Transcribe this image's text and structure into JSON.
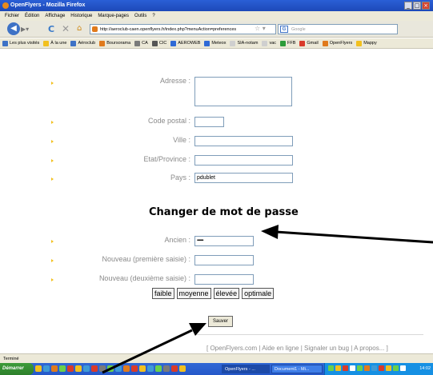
{
  "window": {
    "title": "OpenFlyers - Mozilla Firefox",
    "controls": [
      "_",
      "□",
      "×"
    ]
  },
  "menu": [
    "Fichier",
    "Édition",
    "Affichage",
    "Historique",
    "Marque-pages",
    "Outils",
    "?"
  ],
  "nav": {
    "url": "http://aeroclub-caen.openflyers.fr/index.php?menuAction=preferences",
    "search_placeholder": "Google"
  },
  "bookmarks": [
    {
      "label": "Les plus visités",
      "color": "#3e72c6"
    },
    {
      "label": "À la une",
      "color": "#f2c01e"
    },
    {
      "label": "Aéroclub",
      "color": "#3e72c6"
    },
    {
      "label": "Boursorama",
      "color": "#e07a1d"
    },
    {
      "label": "CA",
      "color": "#7a7a7a"
    },
    {
      "label": "CIC",
      "color": "#555555"
    },
    {
      "label": "AEROWEB",
      "color": "#2f6ad6"
    },
    {
      "label": "Meteox",
      "color": "#2f6ad6"
    },
    {
      "label": "SIA-notam",
      "color": "#cfcfcf"
    },
    {
      "label": "vac",
      "color": "#cfcfcf"
    },
    {
      "label": "FFB",
      "color": "#2d9c3a"
    },
    {
      "label": "Gmail",
      "color": "#d93a2a"
    },
    {
      "label": "OpenFlyers",
      "color": "#e07a1d"
    },
    {
      "label": "Mappy",
      "color": "#f2c01e"
    }
  ],
  "form": {
    "address_label": "Adresse :",
    "postal_label": "Code postal :",
    "city_label": "Ville :",
    "state_label": "Etat/Province :",
    "country_label": "Pays :",
    "country_value": "pdublet"
  },
  "password": {
    "title": "Changer de mot de passe",
    "old_label": "Ancien :",
    "old_value": "••••••••••",
    "new1_label": "Nouveau (première saisie) :",
    "new2_label": "Nouveau (deuxième saisie) :",
    "strength": [
      "faible",
      "moyenne",
      "élevée",
      "optimale"
    ],
    "save_label": "Sauver"
  },
  "footer": "[ OpenFlyers.com | Aide en ligne | Signaler un bug | A propos... ]",
  "status": "Terminé",
  "taskbar": {
    "start": "Démarrer",
    "task1": "OpenFlyers - ...",
    "task2": "Document1 - Mi...",
    "clock": "14:02"
  }
}
